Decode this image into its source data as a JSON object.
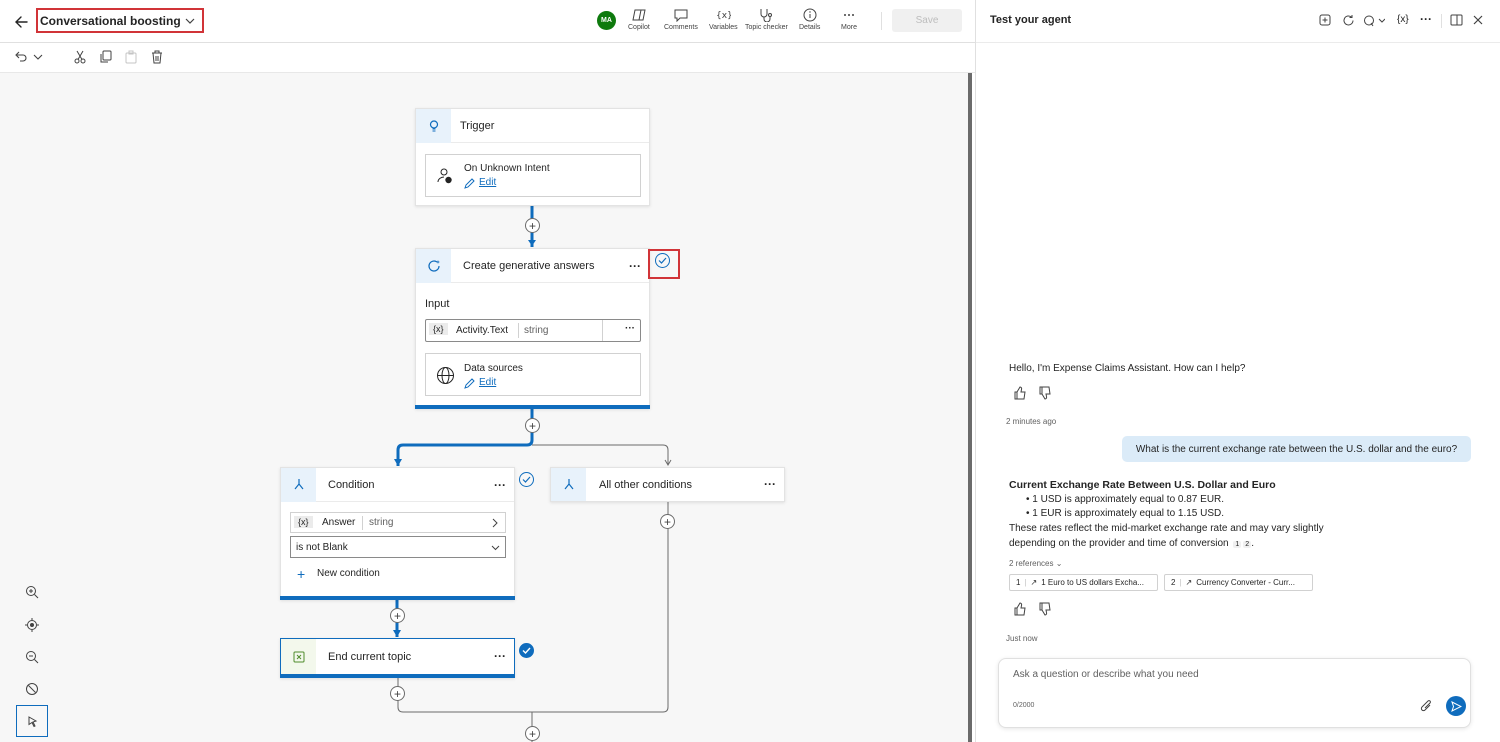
{
  "header": {
    "topic_name": "Conversational boosting",
    "avatar_initials": "MA",
    "tools": [
      {
        "label": "Copilot",
        "icon": "copilot-icon"
      },
      {
        "label": "Comments",
        "icon": "comment-icon"
      },
      {
        "label": "Variables",
        "icon": "variables-icon"
      },
      {
        "label": "Topic checker",
        "icon": "stethoscope-icon"
      },
      {
        "label": "Details",
        "icon": "info-icon"
      },
      {
        "label": "More",
        "icon": "more-icon"
      }
    ],
    "save_label": "Save"
  },
  "canvas": {
    "trigger": {
      "title": "Trigger",
      "item_label": "On Unknown Intent",
      "edit_label": "Edit"
    },
    "generative": {
      "title": "Create generative answers",
      "input_label": "Input",
      "var_prefix": "{x}",
      "var_name": "Activity.Text",
      "var_type": "string",
      "sources_label": "Data sources",
      "edit_label": "Edit"
    },
    "condition": {
      "title": "Condition",
      "var_prefix": "{x}",
      "var_name": "Answer",
      "var_type": "string",
      "operator": "is not Blank",
      "new_condition_label": "New condition"
    },
    "other_conditions": {
      "title": "All other conditions"
    },
    "end": {
      "title": "End current topic"
    }
  },
  "test_panel": {
    "title": "Test your agent",
    "greeting": "Hello, I'm Expense Claims Assistant. How can I help?",
    "greeting_time": "2 minutes ago",
    "user_message": "What is the current exchange rate between the U.S. dollar and the euro?",
    "answer_title": "Current Exchange Rate Between U.S. Dollar and Euro",
    "answer_bullets": [
      "1 USD is approximately equal to 0.87 EUR.",
      "1 EUR is approximately equal to 1.15 USD."
    ],
    "answer_text_line1": "These rates reflect the mid-market exchange rate and may vary slightly",
    "answer_text_line2": "depending on the provider and time of conversion",
    "cite1": "1",
    "cite2": "2",
    "references_label": "2 references",
    "references": [
      {
        "num": "1",
        "label": "1 Euro to US dollars Excha..."
      },
      {
        "num": "2",
        "label": "Currency Converter - Curr..."
      }
    ],
    "answer_time": "Just now",
    "input_placeholder": "Ask a question or describe what you need",
    "char_count": "0/2000"
  }
}
